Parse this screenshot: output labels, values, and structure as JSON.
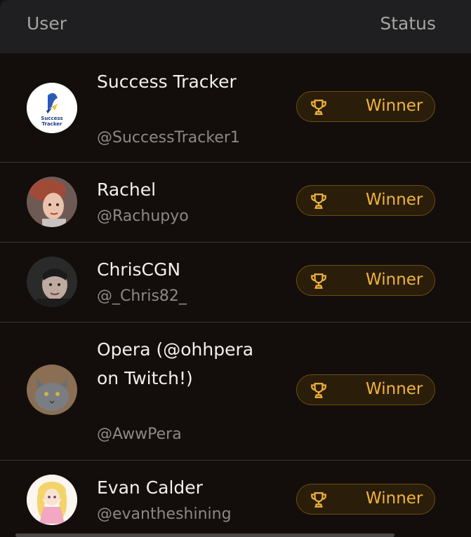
{
  "table": {
    "header": {
      "user": "User",
      "status": "Status"
    },
    "rows": [
      {
        "name": "Success Tracker",
        "handle": "@SuccessTracker1",
        "status": "Winner",
        "avatar": "success-tracker-logo"
      },
      {
        "name": "Rachel",
        "handle": "@Rachupyo",
        "status": "Winner",
        "avatar": "rachel-photo"
      },
      {
        "name": "ChrisCGN",
        "handle": "@_Chris82_",
        "status": "Winner",
        "avatar": "chris-photo"
      },
      {
        "name": "Opera (@ohhpera on Twitch!)",
        "handle": "@AwwPera",
        "status": "Winner",
        "avatar": "cat-photo"
      },
      {
        "name": "Evan Calder",
        "handle": "@evantheshining",
        "status": "Winner",
        "avatar": "anime-character"
      }
    ]
  },
  "logo_text": {
    "line1": "Success",
    "line2": "Tracker"
  },
  "colors": {
    "accent": "#f2b33a",
    "background": "#130e0b",
    "header": "#1f1f21"
  },
  "icons": {
    "status": "trophy-icon"
  }
}
